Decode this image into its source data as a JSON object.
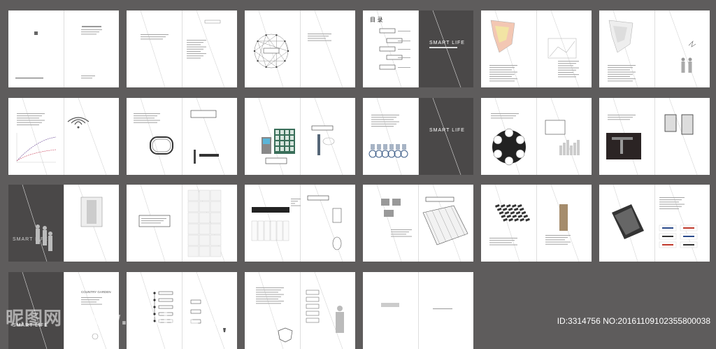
{
  "spreads": [
    {
      "col": 0,
      "row": 0,
      "variant": "cover"
    },
    {
      "col": 1,
      "row": 0,
      "variant": "text"
    },
    {
      "col": 2,
      "row": 0,
      "variant": "network"
    },
    {
      "col": 3,
      "row": 0,
      "variant": "toc",
      "label": "目 录",
      "right_text": "SMART LIFE"
    },
    {
      "col": 4,
      "row": 0,
      "variant": "map"
    },
    {
      "col": 5,
      "row": 0,
      "variant": "map-people"
    },
    {
      "col": 0,
      "row": 1,
      "variant": "wifi"
    },
    {
      "col": 1,
      "row": 1,
      "variant": "track"
    },
    {
      "col": 2,
      "row": 1,
      "variant": "kiosk"
    },
    {
      "col": 3,
      "row": 1,
      "variant": "bikes",
      "right_text": "SMART LIFE"
    },
    {
      "col": 4,
      "row": 1,
      "variant": "circles"
    },
    {
      "col": 5,
      "row": 1,
      "variant": "doors"
    },
    {
      "col": 0,
      "row": 2,
      "variant": "elevator",
      "left_text": "SMART LIFE"
    },
    {
      "col": 1,
      "row": 2,
      "variant": "tiles"
    },
    {
      "col": 2,
      "row": 2,
      "variant": "kitchen"
    },
    {
      "col": 3,
      "row": 2,
      "variant": "floorplan"
    },
    {
      "col": 4,
      "row": 2,
      "variant": "pattern"
    },
    {
      "col": 5,
      "row": 2,
      "variant": "brands"
    },
    {
      "col": 0,
      "row": 3,
      "variant": "country",
      "left_text": "SMART LIFE",
      "right_text": "COUNTRY GARDEN"
    },
    {
      "col": 1,
      "row": 3,
      "variant": "flow"
    },
    {
      "col": 2,
      "row": 3,
      "variant": "presenter"
    },
    {
      "col": 3,
      "row": 3,
      "variant": "back"
    }
  ],
  "watermark": "昵图网 www.nipic.com",
  "id_text": "ID:3314756 NO:20161109102355800038",
  "colors": {
    "background": "#5e5c5c",
    "page": "#ffffff",
    "dark_page": "#4a4848"
  }
}
